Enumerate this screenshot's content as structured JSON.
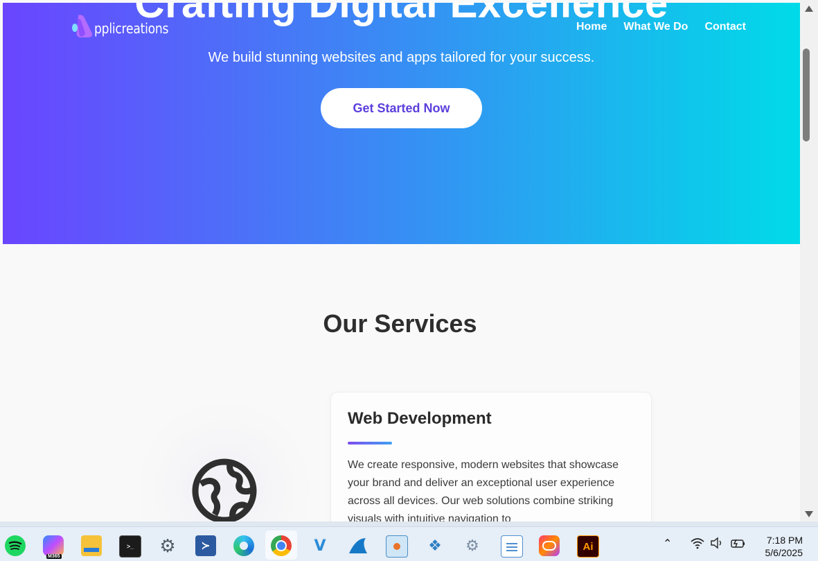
{
  "brand": {
    "name": "pplicreations"
  },
  "nav": {
    "home": "Home",
    "what_we_do": "What We Do",
    "contact": "Contact"
  },
  "hero": {
    "title": "Crafting Digital Excellence",
    "subtitle": "We build stunning websites and apps tailored for your success.",
    "cta_label": "Get Started Now"
  },
  "services": {
    "heading": "Our Services",
    "cards": [
      {
        "icon": "globe-icon",
        "title": "Web Development",
        "text": "We create responsive, modern websites that showcase your brand and deliver an exceptional user experience across all devices. Our web solutions combine striking visuals with intuitive navigation to"
      }
    ]
  },
  "colors": {
    "gradient_start": "#6a45ff",
    "gradient_end": "#00dbe8",
    "cta_text": "#5b3fdc"
  },
  "taskbar": {
    "apps": [
      "spotify-icon",
      "m365-copilot-icon",
      "file-explorer-icon",
      "terminal-icon",
      "settings-icon",
      "powershell-icon",
      "edge-icon",
      "chrome-icon",
      "visual-studio-icon",
      "wireshark-icon",
      "monitor-app-icon",
      "network-app-icon",
      "gears-app-icon",
      "notepad-icon",
      "creative-cloud-icon",
      "illustrator-icon"
    ],
    "m365_label": "M365",
    "illustrator_label": "Ai",
    "time": "7:18 PM",
    "date": "5/6/2025"
  }
}
